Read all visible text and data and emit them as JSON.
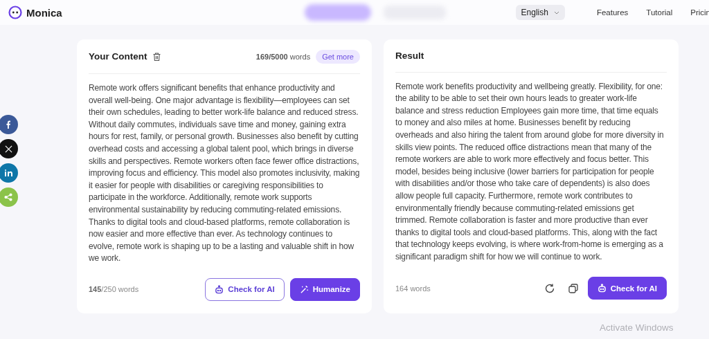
{
  "header": {
    "brand": "Monica",
    "language": "English",
    "nav": [
      "Features",
      "Tutorial",
      "Pricin"
    ]
  },
  "share": [
    {
      "kind": "facebook",
      "color": "#3b5998"
    },
    {
      "kind": "x",
      "color": "#111111"
    },
    {
      "kind": "linkedin",
      "color": "#0e76a8"
    },
    {
      "kind": "share",
      "color": "#8bc34a"
    }
  ],
  "input_panel": {
    "title": "Your Content",
    "word_count": "**169/5000** words",
    "get_more": "Get more",
    "text": "Remote work offers significant benefits that enhance productivity and overall well-being. One major advantage is flexibility—employees can set their own schedules, leading to better work-life balance and reduced stress. Without daily commutes, individuals save time and money, gaining extra hours for rest, family, or personal growth. Businesses also benefit by cutting overhead costs and accessing a global talent pool, which brings in diverse skills and perspectives. Remote workers often face fewer office distractions, improving focus and efficiency. This model also promotes inclusivity, making it easier for people with disabilities or caregiving responsibilities to participate in the workforce. Additionally, remote work supports environmental sustainability by reducing commuting-related emissions. Thanks to digital tools and cloud-based platforms, remote collaboration is now easier and more effective than ever. As technology continues to evolve, remote work is shaping up to be a lasting and valuable shift in how we work.",
    "footer_count": "**145**/250 words",
    "buttons": [
      {
        "label": "Check for AI",
        "kind": "outline"
      },
      {
        "label": "Humanize",
        "kind": "primary"
      }
    ]
  },
  "result_panel": {
    "title": "Result",
    "text": "Remote work benefits productivity and wellbeing greatly. Flexibility, for one: the ability to be able to set their own hours leads to greater work-life balance and stress reduction Employees gain more time, that time equals to money and also miles at home. Businesses benefit by reducing overheads and also hiring the talent from around globe for more diversity in skills view points. The reduced office distractions mean that many of the remote workers are able to work more effectively and focus better. This model, besides being inclusive (lower barriers for participation for people with disabilities and/or those who take care of dependents) is also does allow people full capacity. Furthermore, remote work contributes to environmentally friendly because commuting-related emissions get trimmed. Remote collaboration is faster and more productive than ever thanks to digital tools and cloud-based platforms. This, along with the fact that technology keeps evolving, is where work-from-home is emerging as a significant paradigm shift for how we will continue to work.",
    "footer_count": "164 words",
    "button": "Check for AI"
  },
  "os_notice": "Activate Windows"
}
